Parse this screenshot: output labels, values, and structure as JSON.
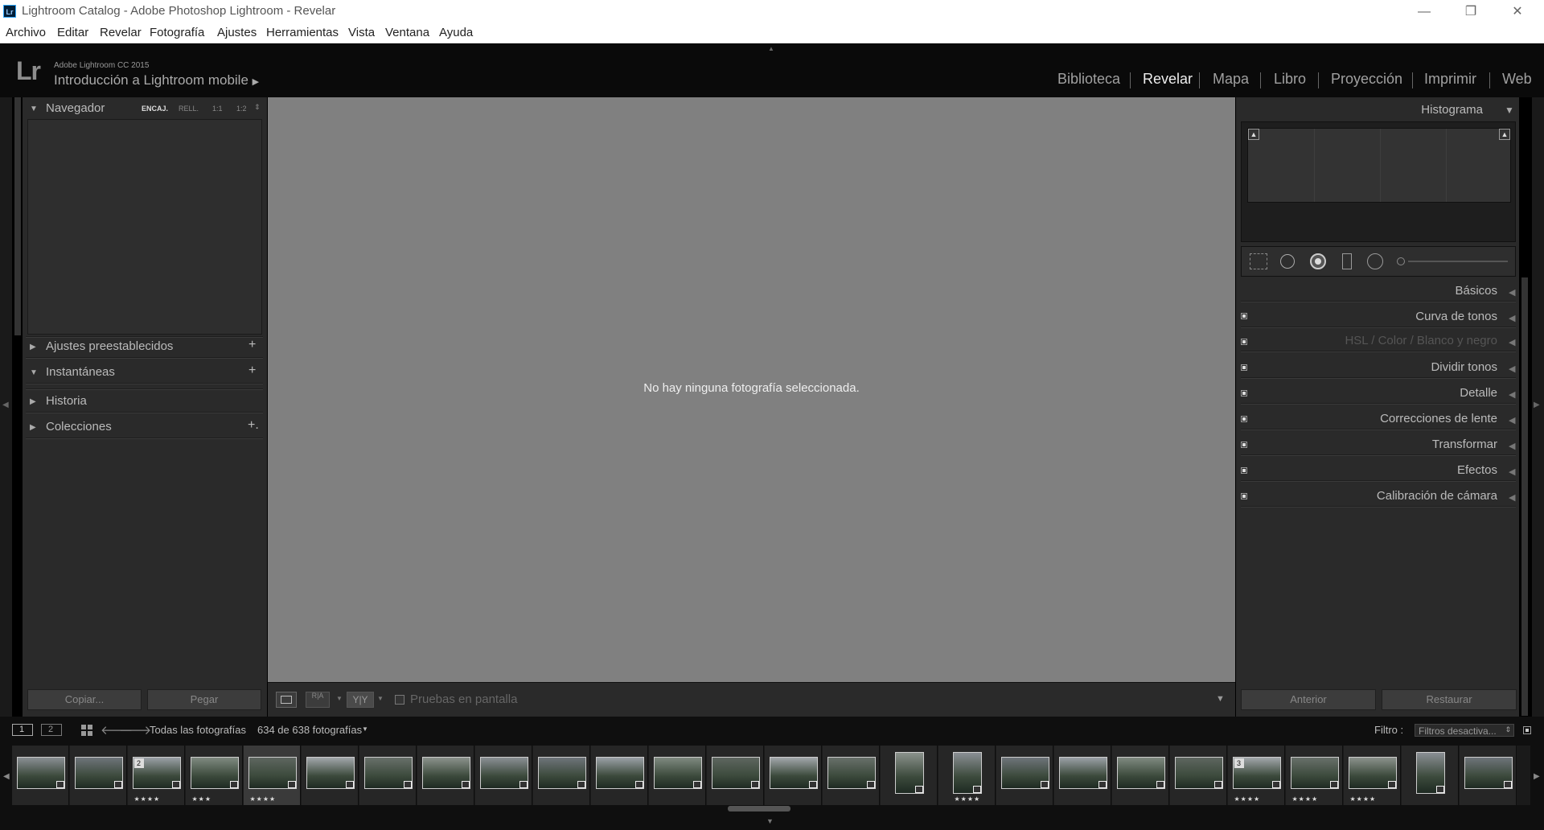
{
  "window": {
    "title": "Lightroom Catalog - Adobe Photoshop Lightroom - Revelar",
    "app_icon": "Lr"
  },
  "window_controls": {
    "minimize": "—",
    "restore": "❐",
    "close": "✕"
  },
  "menu": [
    "Archivo",
    "Editar",
    "Revelar",
    "Fotografía",
    "Ajustes",
    "Herramientas",
    "Vista",
    "Ventana",
    "Ayuda"
  ],
  "header": {
    "logo": "Lr",
    "product": "Adobe Lightroom CC 2015",
    "catalog": "Introducción a Lightroom mobile",
    "modules": [
      "Biblioteca",
      "Revelar",
      "Mapa",
      "Libro",
      "Proyección",
      "Imprimir",
      "Web"
    ],
    "active_module": "Revelar"
  },
  "left_panel": {
    "navigator": {
      "title": "Navegador",
      "zoom": [
        "ENCAJ.",
        "RELL.",
        "1:1",
        "1:2"
      ]
    },
    "sections": [
      {
        "label": "Ajustes preestablecidos",
        "action": "+"
      },
      {
        "label": "Instantáneas",
        "action": "+"
      },
      {
        "label": "Historia",
        "action": ""
      },
      {
        "label": "Colecciones",
        "action": "+."
      }
    ],
    "buttons": {
      "copy": "Copiar...",
      "paste": "Pegar"
    }
  },
  "center": {
    "message": "No hay ninguna fotografía seleccionada.",
    "toolbar": {
      "proof_label": "Pruebas en pantalla",
      "yy_label": "Y|Y",
      "ra_label": "R|A"
    }
  },
  "right_panel": {
    "histogram_title": "Histograma",
    "sections": [
      {
        "label": "Básicos",
        "switch": false
      },
      {
        "label": "Curva de tonos",
        "switch": true
      },
      {
        "label": "HSL / Color / Blanco y negro",
        "switch": true,
        "dimmed": true
      },
      {
        "label": "Dividir tonos",
        "switch": true
      },
      {
        "label": "Detalle",
        "switch": true
      },
      {
        "label": "Correcciones de lente",
        "switch": true
      },
      {
        "label": "Transformar",
        "switch": true
      },
      {
        "label": "Efectos",
        "switch": true
      },
      {
        "label": "Calibración de cámara",
        "switch": true
      }
    ],
    "buttons": {
      "previous": "Anterior",
      "reset": "Restaurar"
    }
  },
  "filmstrip_bar": {
    "screen1": "1",
    "screen2": "2",
    "source": "Todas las fotografías",
    "count": "634 de 638 fotografías",
    "filter_label": "Filtro :",
    "filter_value": "Filtros desactiva..."
  },
  "filmstrip": {
    "thumbs": [
      {
        "stars": "",
        "badge": ""
      },
      {
        "stars": "",
        "badge": ""
      },
      {
        "stars": "★★★★",
        "badge": "2"
      },
      {
        "stars": "★★★",
        "badge": ""
      },
      {
        "stars": "★★★★",
        "badge": ""
      },
      {
        "stars": "",
        "badge": ""
      },
      {
        "stars": "",
        "badge": ""
      },
      {
        "stars": "",
        "badge": ""
      },
      {
        "stars": "",
        "badge": ""
      },
      {
        "stars": "",
        "badge": ""
      },
      {
        "stars": "",
        "badge": ""
      },
      {
        "stars": "",
        "badge": ""
      },
      {
        "stars": "",
        "badge": ""
      },
      {
        "stars": "",
        "badge": ""
      },
      {
        "stars": "",
        "badge": ""
      },
      {
        "stars": "",
        "badge": ""
      },
      {
        "stars": "★★★★",
        "badge": ""
      },
      {
        "stars": "",
        "badge": ""
      },
      {
        "stars": "",
        "badge": ""
      },
      {
        "stars": "",
        "badge": ""
      },
      {
        "stars": "",
        "badge": ""
      },
      {
        "stars": "★★★★",
        "badge": "3"
      },
      {
        "stars": "★★★★",
        "badge": ""
      },
      {
        "stars": "★★★★",
        "badge": ""
      },
      {
        "stars": "",
        "badge": ""
      },
      {
        "stars": "",
        "badge": ""
      }
    ]
  }
}
